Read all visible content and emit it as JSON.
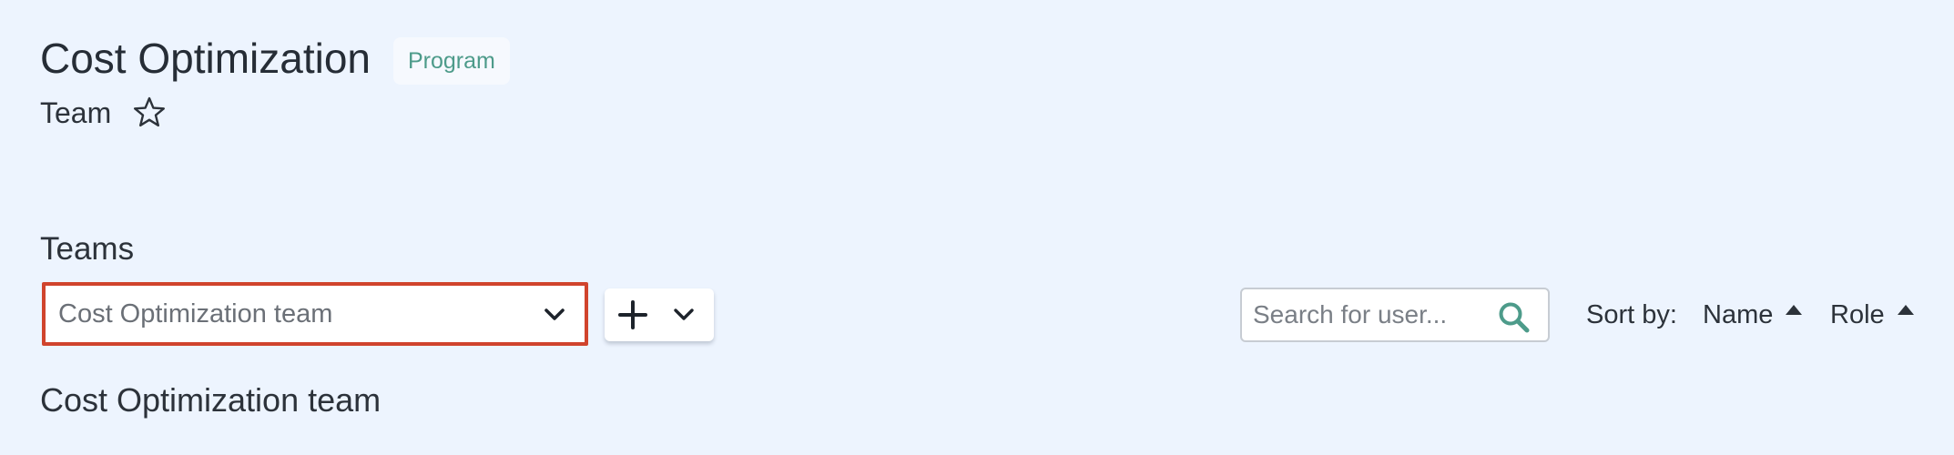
{
  "header": {
    "title": "Cost Optimization",
    "badge": "Program",
    "subtitle": "Team",
    "favorite_icon": "star-outline-icon"
  },
  "teams": {
    "section_title": "Teams",
    "selector": {
      "selected_value": "Cost Optimization team",
      "icon": "chevron-down-icon",
      "highlight_color": "#d0442d"
    },
    "add_menu": {
      "add_icon": "plus-icon",
      "menu_icon": "chevron-down-icon"
    },
    "search": {
      "placeholder": "Search for user...",
      "value": "",
      "icon": "search-icon",
      "icon_color": "#4d9b8a"
    },
    "sort": {
      "label": "Sort by:",
      "options": [
        {
          "label": "Name",
          "direction": "ascending",
          "icon": "caret-up-icon"
        },
        {
          "label": "Role",
          "direction": "ascending",
          "icon": "caret-up-icon"
        }
      ]
    },
    "current_team_heading": "Cost Optimization team"
  },
  "colors": {
    "background": "#edf4fe",
    "badge_text": "#4d9b8a",
    "text": "#2c323a"
  }
}
